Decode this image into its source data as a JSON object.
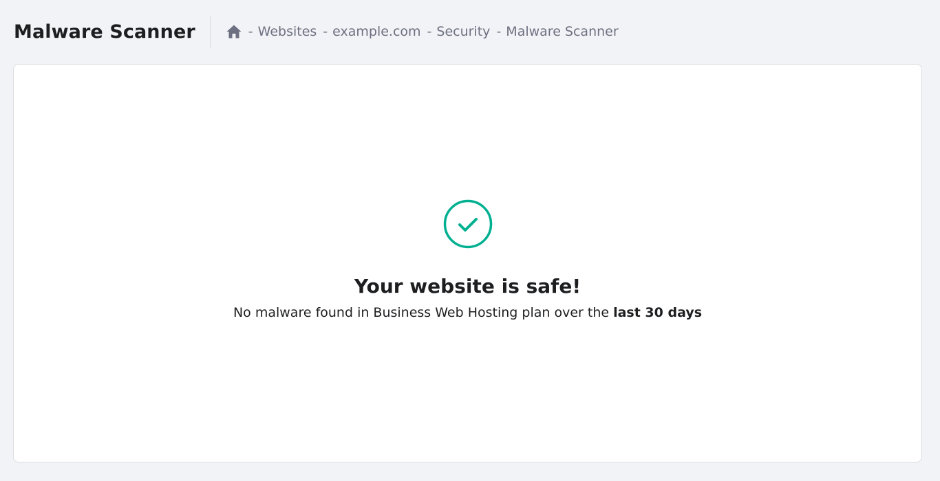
{
  "header": {
    "title": "Malware Scanner"
  },
  "breadcrumb": {
    "home_icon": "home-icon",
    "separator": "-",
    "items": [
      {
        "label": "Websites"
      },
      {
        "label": "example.com"
      },
      {
        "label": "Security"
      },
      {
        "label": "Malware Scanner"
      }
    ]
  },
  "status": {
    "icon": "check-circle-icon",
    "title": "Your website is safe!",
    "description_prefix": "No malware found in Business Web Hosting plan over the",
    "description_highlight": "last 30 days"
  },
  "colors": {
    "background": "#f2f3f6",
    "card": "#ffffff",
    "success": "#00b090",
    "muted_text": "#6d7081",
    "text": "#1d1e20"
  }
}
